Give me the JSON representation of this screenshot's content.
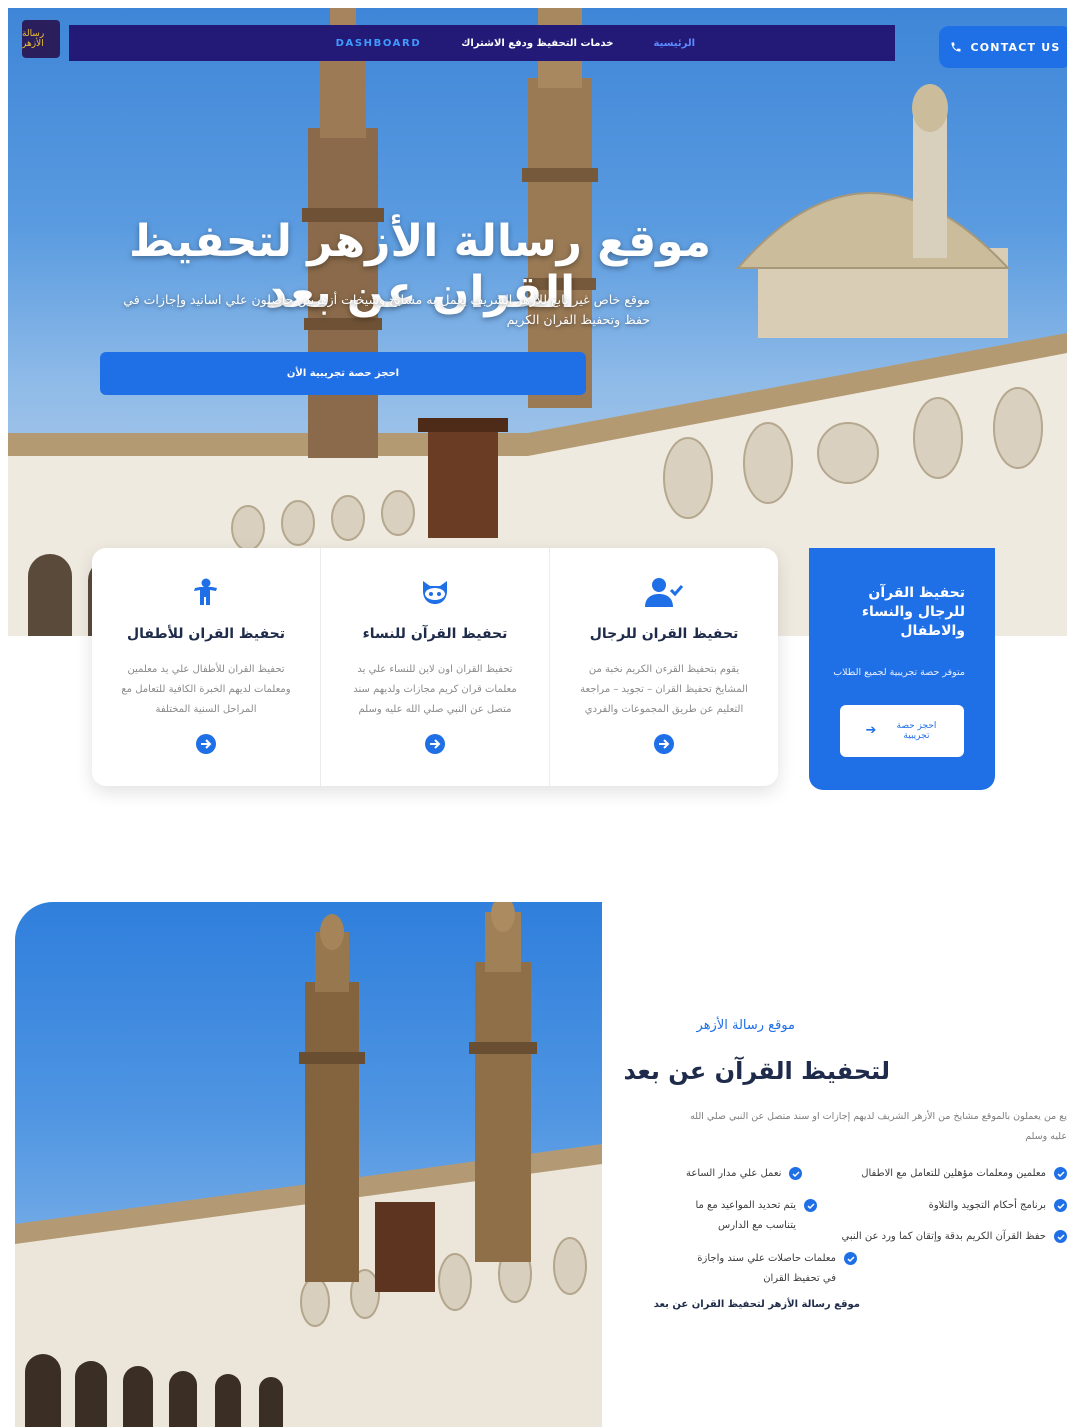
{
  "header": {
    "logo_text": "رسالة الأزهر",
    "nav": [
      "الرئيسية",
      "خدمات التحفيظ ودفع الاشتراك",
      "DASHBOARD"
    ],
    "contact_label": "CONTACT US"
  },
  "hero": {
    "title": "موقع رسالة الأزهر لتحفيظ القران عن بعد",
    "subtitle": "موقع خاص غير تابع للأزهر الشريف يعمل به مشايخ وشيخات أزهريين حاصلون علي اسانيد وإجازات في حفظ وتحفيظ القران الكريم",
    "cta": "احجز حصة تجريبية الأن"
  },
  "services": [
    {
      "icon": "child-icon",
      "title": "تحفيظ القران للأطفال",
      "text": "تحفيظ القران للأطفال علي يد معلمين ومعلمات لديهم الخبرة الكافية للتعامل مع المراحل السنية المختلفة"
    },
    {
      "icon": "github-cat-icon",
      "title": "تحفيظ القرآن للنساء",
      "text": "تحفيظ القران اون لاين للنساء علي يد معلمات قران كريم مجازات ولديهم سند متصل عن النبي صلي الله عليه وسلم"
    },
    {
      "icon": "user-check-icon",
      "title": "تحفيظ القران للرجال",
      "text": "يقوم بتحفيظ القرءن الكريم نخبة من المشايخ تحفيظ القران – تجويد – مراجعة التعليم عن طريق المجموعات والفردي"
    }
  ],
  "promo": {
    "title": "تحفيظ القرآن للرجال والنساء والاطفال",
    "text": "متوفر حصة تجريبية لجميع الطلاب",
    "button": "احجز حصة تجريبية"
  },
  "about": {
    "kicker": "موقع رسالة الأزهر",
    "title": "لتحفيظ القرآن عن بعد",
    "text_line1": "يع من يعملون بالموقع مشايخ من الأزهر الشريف لديهم إجازات او سند متصل عن النبي صلي الله",
    "text_line2": "عليه وسلم",
    "features": [
      "معلمين ومعلمات مؤهلين للتعامل مع الاطفال",
      "نعمل علي مدار الساعة",
      "برنامج أحكام التجويد والتلاوة",
      "يتم تحديد المواعيد مع ما يتناسب مع الدارس",
      "حفظ القرآن الكريم بدقة وإتقان كما ورد عن النبي",
      "معلمات حاصلات علي سند واجازة في تحفيظ القران"
    ],
    "footer": "موقع رسالة الأزهر لتحفيظ القران عن بعد"
  },
  "colors": {
    "primary": "#1f6fe6",
    "nav_bg": "#231a78",
    "heading": "#1e2b4a"
  }
}
